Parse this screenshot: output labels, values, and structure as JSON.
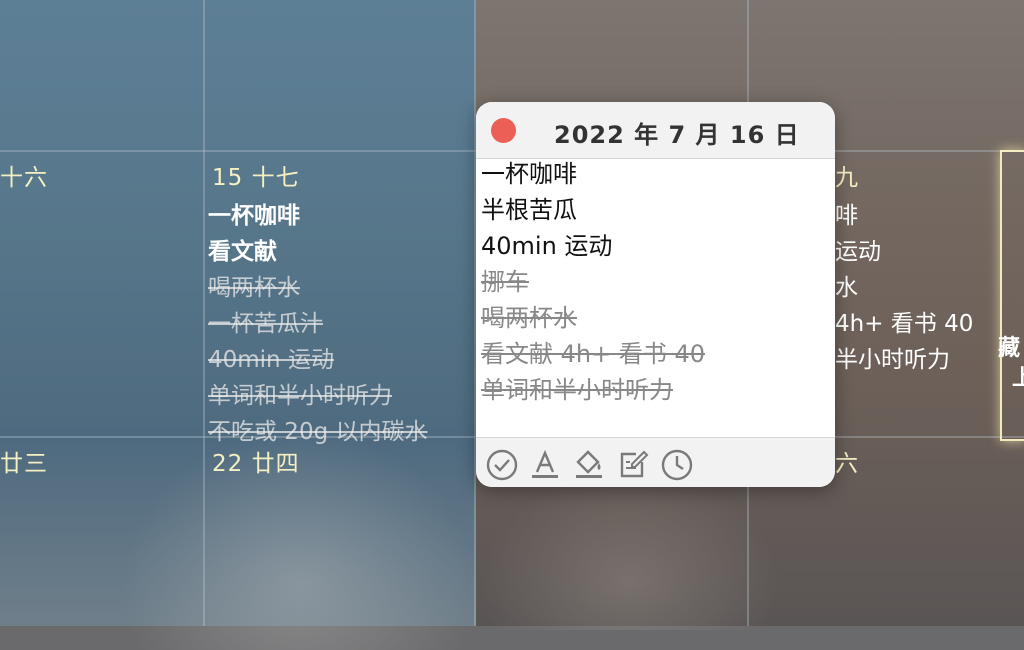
{
  "calendar": {
    "labels": {
      "col0_week3": "十六",
      "col1_week3": "15  十七",
      "col3_week3": "九",
      "col0_week4": "廿三",
      "col1_week4": "22  廿四",
      "col3_week4": "六"
    },
    "day15_tasks": [
      {
        "text": "一杯咖啡",
        "done": false
      },
      {
        "text": "看文献",
        "done": false
      },
      {
        "text": "喝两杯水",
        "done": true
      },
      {
        "text": "一杯苦瓜汁",
        "done": true
      },
      {
        "text": "40min 运动",
        "done": true
      },
      {
        "text": "单词和半小时听力",
        "done": true
      },
      {
        "text": "不吃或 20g 以内碳水",
        "done": true
      }
    ],
    "day16_partial": [
      "啡",
      "运动",
      "水",
      "4h+ 看书 40",
      "半小时听力"
    ],
    "edge_text": [
      "藏",
      "上"
    ]
  },
  "popup": {
    "title": "2022 年 7 月 16 日",
    "tasks": [
      {
        "text": "一杯咖啡",
        "done": false
      },
      {
        "text": "半根苦瓜",
        "done": false
      },
      {
        "text": "40min 运动",
        "done": false
      },
      {
        "text": "挪车",
        "done": true
      },
      {
        "text": "喝两杯水",
        "done": true
      },
      {
        "text": "看文献 4h+ 看书 40",
        "done": true
      },
      {
        "text": "单词和半小时听力",
        "done": true
      }
    ],
    "toolbar": [
      "checkmark-circle-icon",
      "text-color-icon",
      "fill-color-icon",
      "edit-note-icon",
      "clock-icon"
    ]
  },
  "colors": {
    "accent_date": "#f4f0c2",
    "close": "#ec5f57"
  }
}
